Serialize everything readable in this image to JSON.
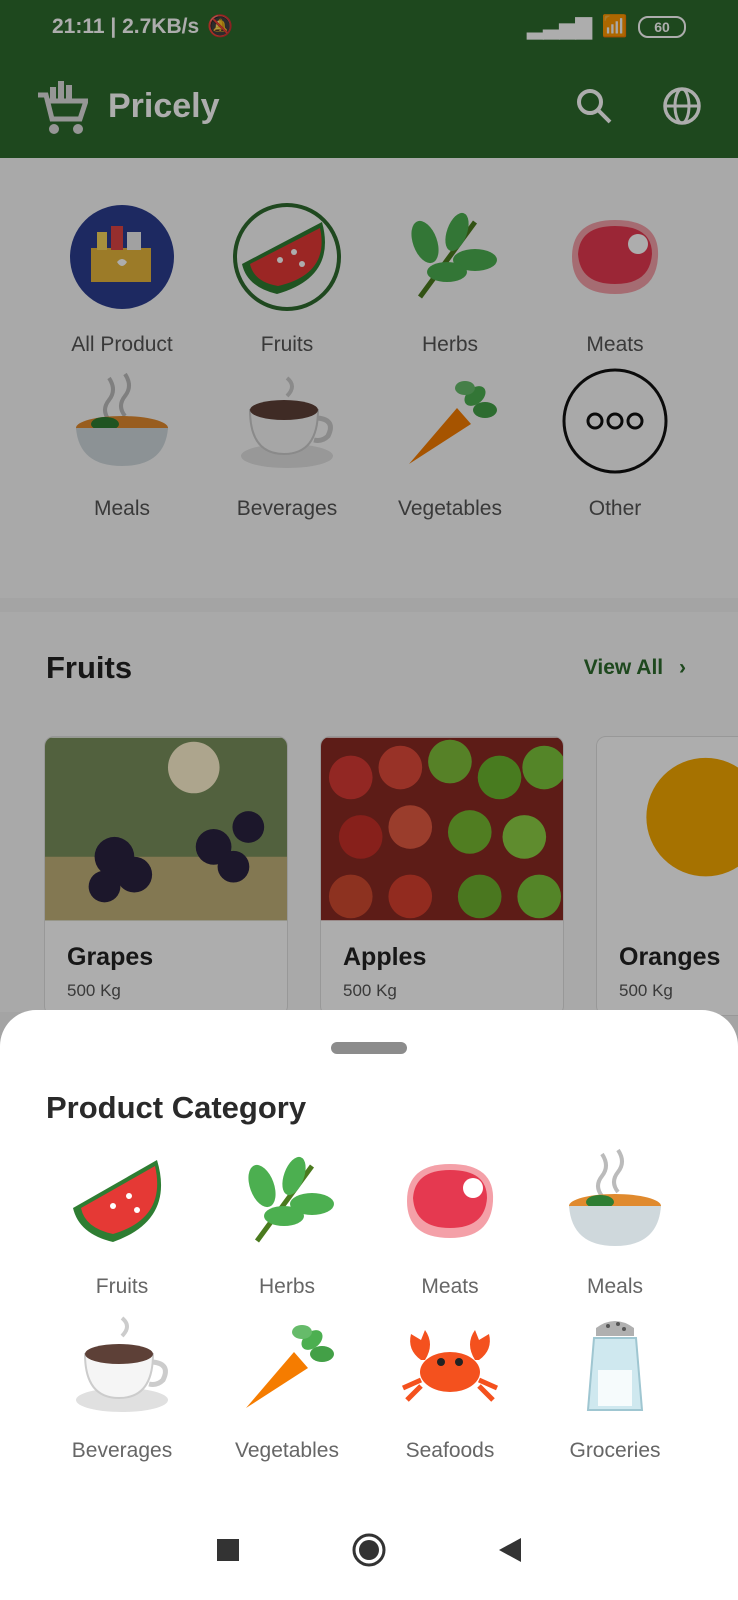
{
  "status_bar": {
    "time_speed": "21:11 | 2.7KB/s",
    "battery": "60"
  },
  "app_bar": {
    "title": "Pricely"
  },
  "categories": [
    {
      "label": "All Product",
      "icon": "all-product-icon"
    },
    {
      "label": "Fruits",
      "icon": "watermelon-icon"
    },
    {
      "label": "Herbs",
      "icon": "herb-icon"
    },
    {
      "label": "Meats",
      "icon": "meat-icon"
    },
    {
      "label": "Meals",
      "icon": "meal-bowl-icon"
    },
    {
      "label": "Beverages",
      "icon": "coffee-cup-icon"
    },
    {
      "label": "Vegetables",
      "icon": "carrot-icon"
    },
    {
      "label": "Other",
      "icon": "more-icon"
    }
  ],
  "section": {
    "title": "Fruits",
    "view_all": "View All",
    "cards": [
      {
        "name": "Grapes",
        "subtitle": "500 Kg"
      },
      {
        "name": "Apples",
        "subtitle": "500 Kg"
      },
      {
        "name": "Oranges",
        "subtitle": "500 Kg"
      }
    ]
  },
  "sheet": {
    "title": "Product Category",
    "items": [
      {
        "label": "Fruits",
        "icon": "watermelon-icon"
      },
      {
        "label": "Herbs",
        "icon": "herb-icon"
      },
      {
        "label": "Meats",
        "icon": "meat-icon"
      },
      {
        "label": "Meals",
        "icon": "meal-bowl-icon"
      },
      {
        "label": "Beverages",
        "icon": "coffee-cup-icon"
      },
      {
        "label": "Vegetables",
        "icon": "carrot-icon"
      },
      {
        "label": "Seafoods",
        "icon": "crab-icon"
      },
      {
        "label": "Groceries",
        "icon": "salt-shaker-icon"
      }
    ]
  },
  "colors": {
    "primary": "#2d6b2d",
    "overlay": "rgba(0,0,0,0.32)"
  }
}
